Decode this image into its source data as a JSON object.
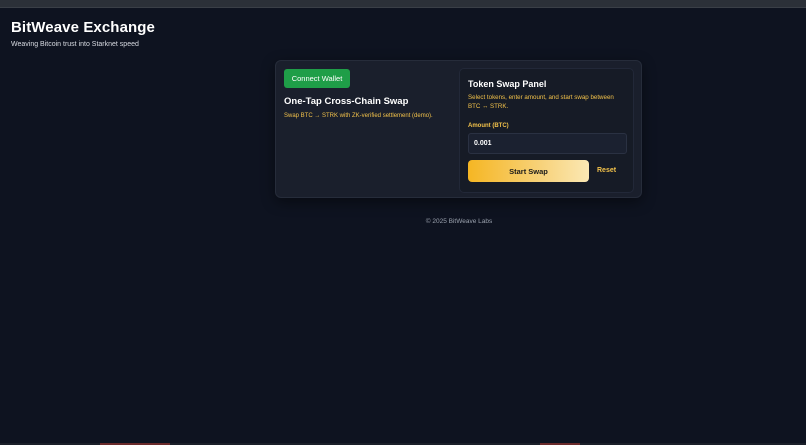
{
  "header": {
    "title": "BitWeave Exchange",
    "tagline": "Weaving Bitcoin trust into Starknet speed"
  },
  "left": {
    "connect_label": "Connect Wallet",
    "title": "One-Tap Cross-Chain Swap",
    "description": "Swap BTC → STRK with ZK-verified settlement (demo)."
  },
  "panel": {
    "title": "Token Swap Panel",
    "description": "Select tokens, enter amount, and start swap between BTC ↔ STRK.",
    "amount_label": "Amount (BTC)",
    "amount_value": "0.001",
    "start_label": "Start Swap",
    "reset_label": "Reset"
  },
  "footer": {
    "text": "© 2025 BitWeave Labs"
  },
  "colors": {
    "background": "#0e1320",
    "card": "#1a1f2c",
    "accent_green": "#1f9e48",
    "accent_gold": "#f3c24a"
  }
}
